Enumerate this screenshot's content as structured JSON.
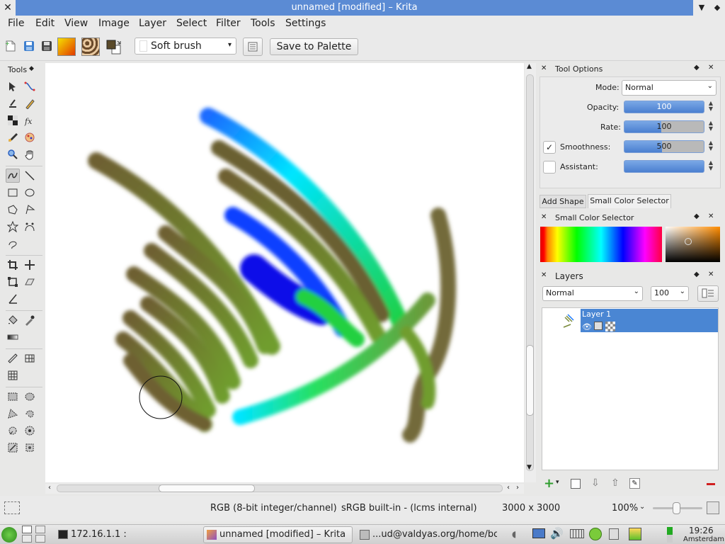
{
  "window": {
    "title": "unnamed [modified] – Krita"
  },
  "menu": [
    "File",
    "Edit",
    "View",
    "Image",
    "Layer",
    "Select",
    "Filter",
    "Tools",
    "Settings"
  ],
  "toolbar": {
    "brush_preset": "Soft brush",
    "save_palette_label": "Save to Palette"
  },
  "tools_docker": {
    "title": "Tools"
  },
  "tool_options": {
    "title": "Tool Options",
    "mode_label": "Mode:",
    "mode_value": "Normal",
    "opacity_label": "Opacity:",
    "opacity_value": "100",
    "opacity_fraction": 1.0,
    "rate_label": "Rate:",
    "rate_value": "100",
    "rate_fraction": 0.46,
    "smoothness_label": "Smoothness:",
    "smoothness_value": "500",
    "smoothness_fraction": 0.47,
    "assistant_label": "Assistant:"
  },
  "docker_tabs": [
    "Add Shape",
    "Small Color Selector"
  ],
  "color_selector": {
    "title": "Small Color Selector"
  },
  "layers": {
    "title": "Layers",
    "blend_mode": "Normal",
    "opacity": "100",
    "items": [
      {
        "name": "Layer 1"
      }
    ]
  },
  "status": {
    "color_space": "RGB (8-bit integer/channel)",
    "profile": "sRGB built-in - (lcms internal)",
    "dimensions": "3000 x 3000",
    "zoom": "100%"
  },
  "taskbar": {
    "terminal": "172.16.1.1 :",
    "krita": "unnamed [modified] – Krita",
    "browser": "...ud@valdyas.org/home/bo",
    "clock": "19:26",
    "city": "Amsterdam"
  },
  "colors": {
    "accent": "#5b8bd4",
    "selection": "#4a86d3"
  }
}
